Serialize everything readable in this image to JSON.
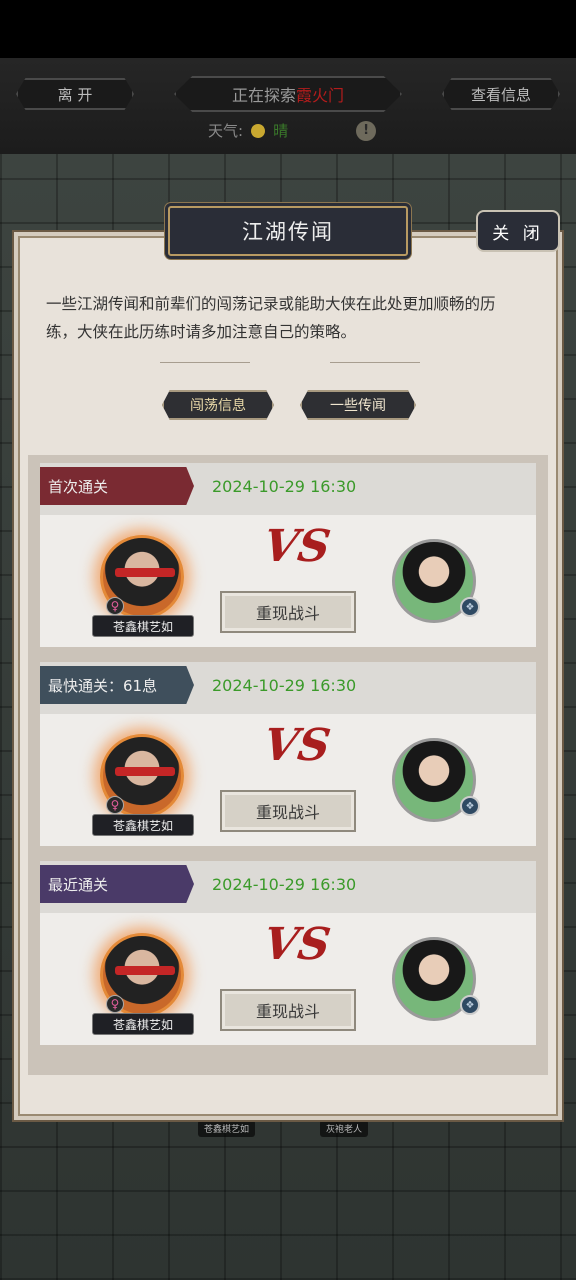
{
  "topbar": {
    "leave_label": "离 开",
    "exploring_label": "正在探索",
    "exploring_place": "霞火门",
    "view_info_label": "查看信息",
    "weather_label": "天气:",
    "weather_value": "晴"
  },
  "background": {
    "char1": "苍鑫棋艺如",
    "char2": "灰袍老人"
  },
  "dialog": {
    "title": "江湖传闻",
    "close_label": "关 闭",
    "description": "一些江湖传闻和前辈们的闯荡记录或能助大侠在此处更加顺畅的历练，大侠在此历练时请多加注意自己的策略。",
    "tabs": [
      {
        "label": "闯荡信息"
      },
      {
        "label": "一些传闻"
      }
    ]
  },
  "records": [
    {
      "label": "首次通关",
      "date": "2024-10-29 16:30",
      "player": "苍鑫棋艺如",
      "vs": "VS",
      "replay": "重现战斗",
      "color": "#7a2a32"
    },
    {
      "label": "最快通关：61息",
      "date": "2024-10-29 16:30",
      "player": "苍鑫棋艺如",
      "vs": "VS",
      "replay": "重现战斗",
      "color": "#3f4f5c"
    },
    {
      "label": "最近通关",
      "date": "2024-10-29 16:30",
      "player": "苍鑫棋艺如",
      "vs": "VS",
      "replay": "重现战斗",
      "color": "#4a3a68"
    }
  ],
  "icons": {
    "sun": "sun-icon",
    "warning": "warning-icon",
    "female": "♀",
    "badge": "❖"
  }
}
